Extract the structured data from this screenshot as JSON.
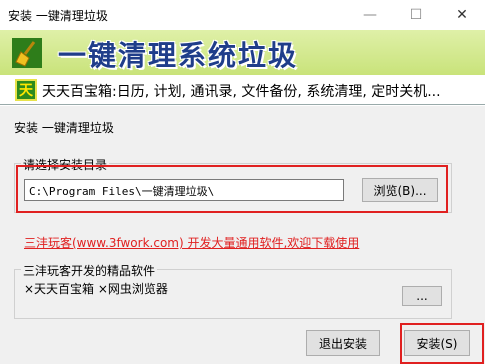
{
  "window": {
    "title": "安装 一键清理垃圾"
  },
  "banner": {
    "title": "一键清理系统垃圾"
  },
  "strip": {
    "badge": "天",
    "text": "天天百宝箱:日历, 计划, 通讯录, 文件备份, 系统清理, 定时关机..."
  },
  "main": {
    "subtitle": "安装 一键清理垃圾",
    "dir_group_label": "请选择安装目录",
    "install_path": "C:\\Program Files\\一键清理垃圾\\",
    "browse_label": "浏览(B)...",
    "promo_link": "三沣玩客(www.3fwork.com) 开发大量通用软件,欢迎下载使用",
    "software_group_label": "三沣玩客开发的精品软件",
    "software_items": "×天天百宝箱 ×网虫浏览器",
    "more_label": "...",
    "exit_label": "退出安装",
    "install_label": "安装(S)"
  }
}
